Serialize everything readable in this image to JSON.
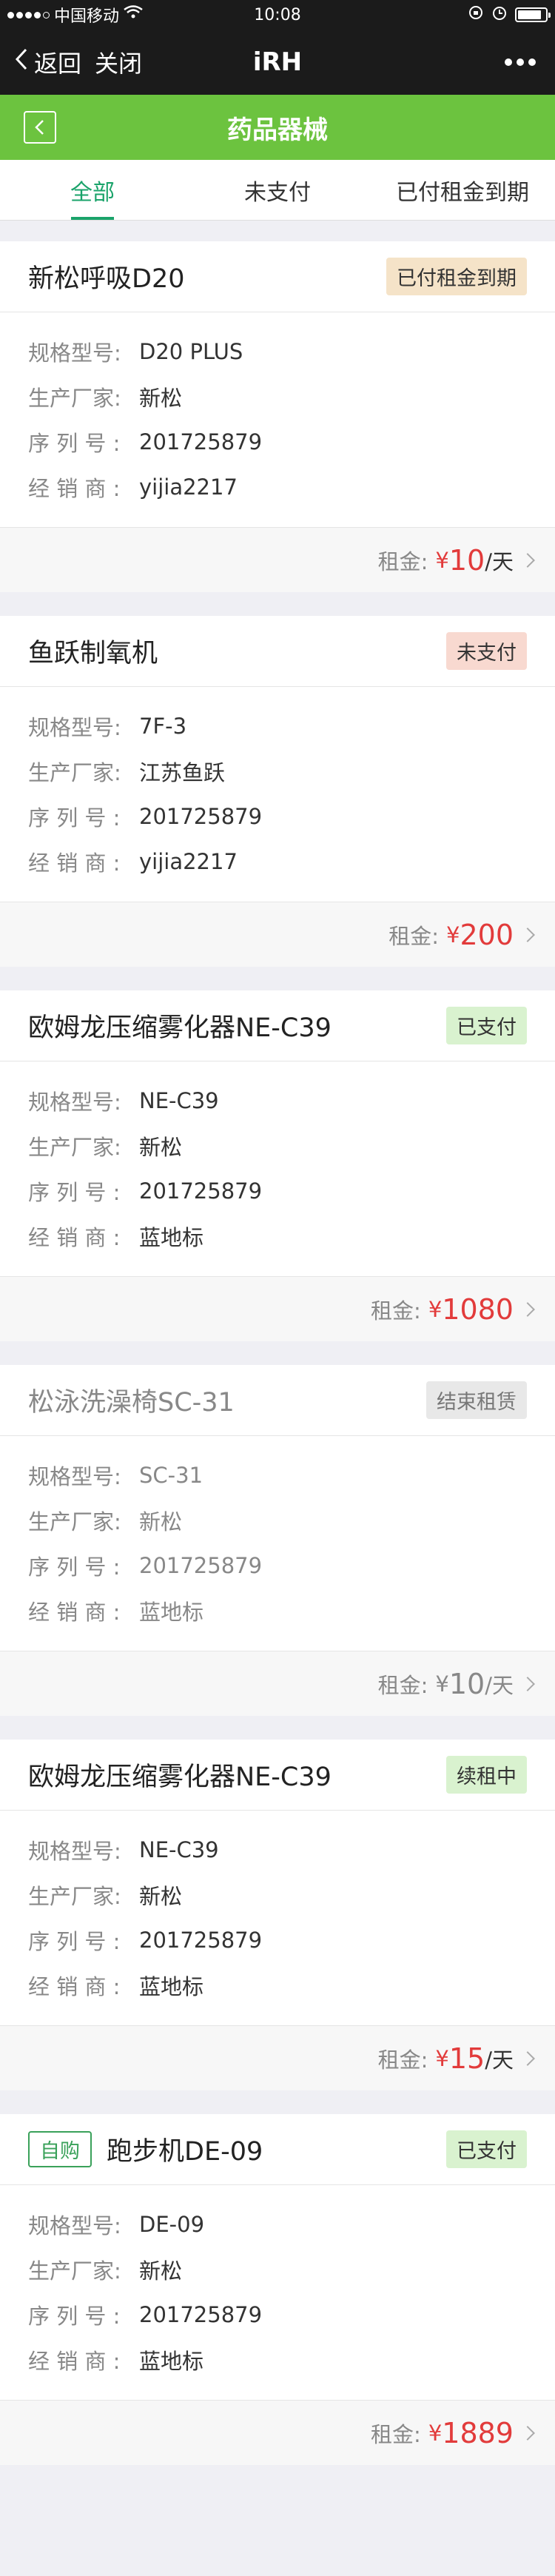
{
  "status": {
    "carrier": "中国移动",
    "time": "10:08"
  },
  "nav": {
    "back": "返回",
    "close": "关闭",
    "title": "iRH"
  },
  "page": {
    "title": "药品器械"
  },
  "tabs": [
    {
      "label": "全部",
      "active": true
    },
    {
      "label": "未支付",
      "active": false
    },
    {
      "label": "已付租金到期",
      "active": false
    }
  ],
  "labels": {
    "model": "规格型号:",
    "maker": "生产厂家:",
    "serial": "序 列 号 :",
    "dealer": "经 销 商 :",
    "rent": "租金:"
  },
  "items": [
    {
      "name": "新松呼吸D20",
      "status": "已付租金到期",
      "model": "D20 PLUS",
      "maker": "新松",
      "serial": "201725879",
      "dealer": "yijia2217",
      "currency": "¥",
      "price": "10",
      "unit": "/天"
    },
    {
      "name": "鱼跃制氧机",
      "status": "未支付",
      "model": "7F-3",
      "maker": "江苏鱼跃",
      "serial": "201725879",
      "dealer": "yijia2217",
      "currency": "¥",
      "price": "200",
      "unit": ""
    },
    {
      "name": "欧姆龙压缩雾化器NE-C39",
      "status": "已支付",
      "model": "NE-C39",
      "maker": "新松",
      "serial": "201725879",
      "dealer": "蓝地标",
      "currency": "¥",
      "price": "1080",
      "unit": ""
    },
    {
      "name": "松泳洗澡椅SC-31",
      "status": "结束租赁",
      "model": "SC-31",
      "maker": "新松",
      "serial": "201725879",
      "dealer": "蓝地标",
      "currency": "¥",
      "price": "10",
      "unit": "/天"
    },
    {
      "name": "欧姆龙压缩雾化器NE-C39",
      "status": "续租中",
      "model": "NE-C39",
      "maker": "新松",
      "serial": "201725879",
      "dealer": "蓝地标",
      "currency": "¥",
      "price": "15",
      "unit": "/天"
    },
    {
      "tag": "自购",
      "name": "跑步机DE-09",
      "status": "已支付",
      "model": "DE-09",
      "maker": "新松",
      "serial": "201725879",
      "dealer": "蓝地标",
      "currency": "¥",
      "price": "1889",
      "unit": ""
    }
  ]
}
